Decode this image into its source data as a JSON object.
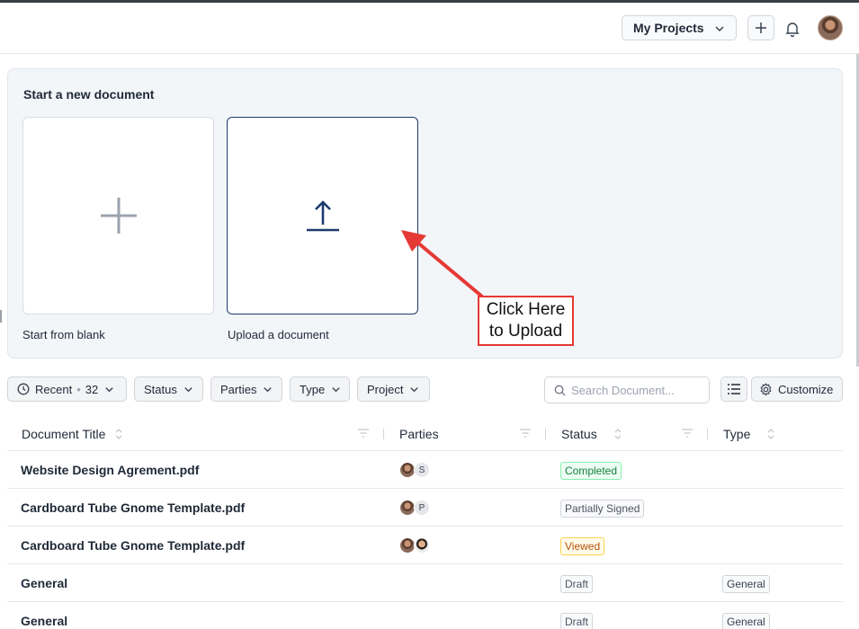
{
  "header": {
    "project_selector": "My Projects"
  },
  "new_document": {
    "title": "Start a new document",
    "blank_label": "Start from blank",
    "upload_label": "Upload a document"
  },
  "callout": {
    "line1": "Click Here",
    "line2": "to Upload"
  },
  "filters": {
    "recent_label": "Recent",
    "recent_count": "32",
    "status": "Status",
    "parties": "Parties",
    "type": "Type",
    "project": "Project",
    "search_placeholder": "Search Document...",
    "customize": "Customize"
  },
  "table": {
    "columns": [
      "Document Title",
      "Parties",
      "Status",
      "Type"
    ],
    "rows": [
      {
        "title": "Website Design Agrement.pdf",
        "parties": [
          "photo",
          "S"
        ],
        "status": "Completed",
        "status_kind": "completed",
        "type": ""
      },
      {
        "title": "Cardboard Tube Gnome Template.pdf",
        "parties": [
          "photo",
          "P"
        ],
        "status": "Partially Signed",
        "status_kind": "partial",
        "type": ""
      },
      {
        "title": "Cardboard Tube Gnome Template.pdf",
        "parties": [
          "photo",
          "photo2"
        ],
        "status": "Viewed",
        "status_kind": "viewed",
        "type": ""
      },
      {
        "title": "General",
        "parties": [],
        "status": "Draft",
        "status_kind": "draft",
        "type": "General"
      },
      {
        "title": "General",
        "parties": [],
        "status": "Draft",
        "status_kind": "draft",
        "type": "General"
      }
    ]
  },
  "colors": {
    "accent_navy": "#1e3a6e",
    "callout_red": "#e53935"
  }
}
